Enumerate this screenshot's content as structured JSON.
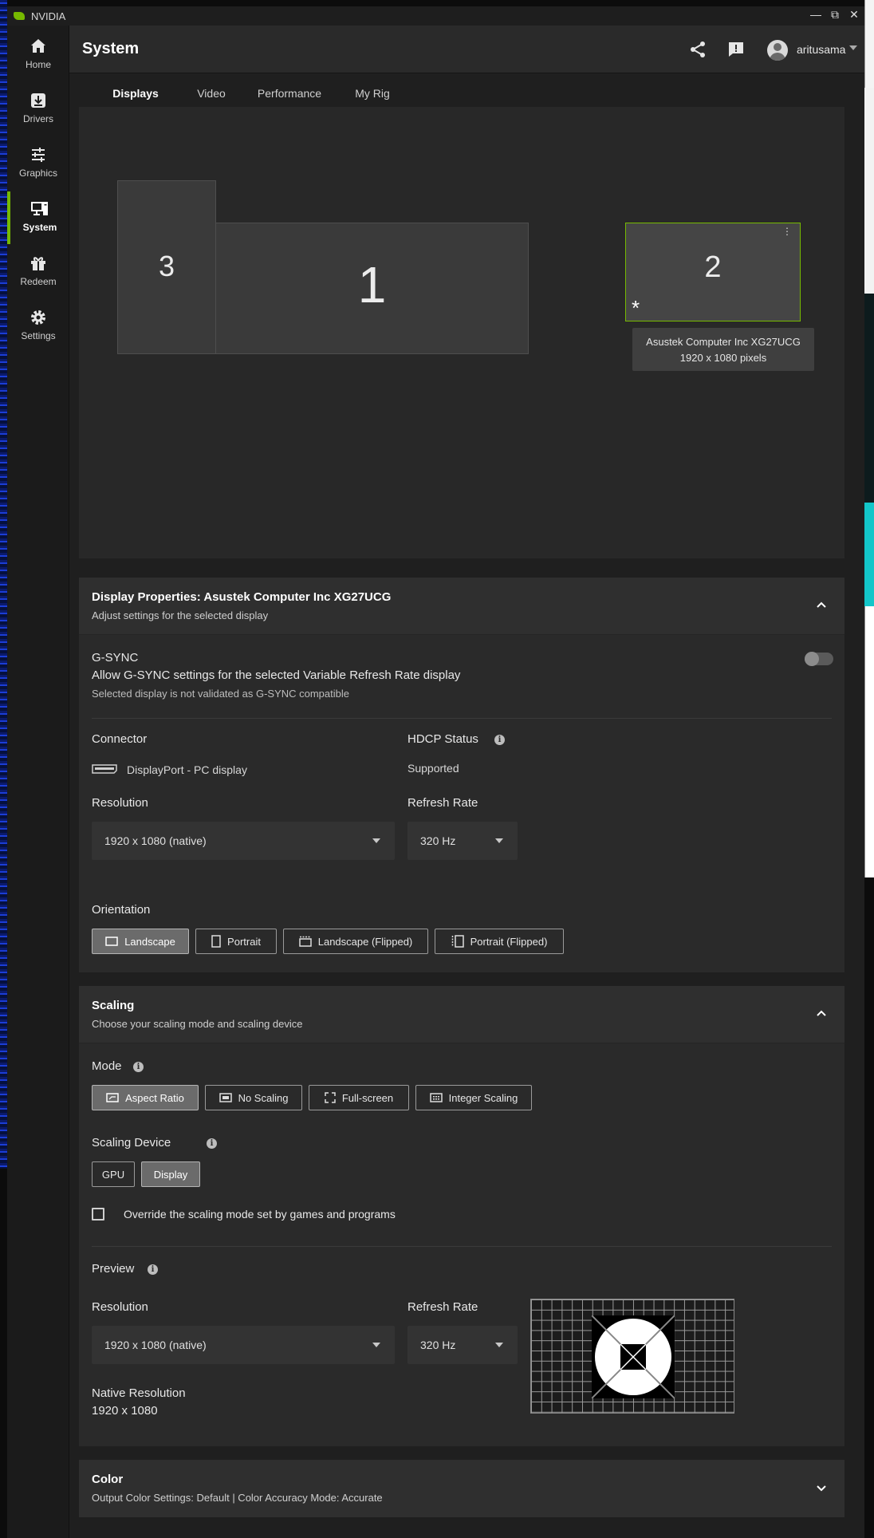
{
  "app": {
    "title": "NVIDIA",
    "brand_color": "#76b900"
  },
  "window_controls": {
    "minimize": "—",
    "restore": "⧉",
    "close": "✕"
  },
  "nav": {
    "items": [
      {
        "label": "Home",
        "icon": "home-icon"
      },
      {
        "label": "Drivers",
        "icon": "download-icon"
      },
      {
        "label": "Graphics",
        "icon": "sliders-icon"
      },
      {
        "label": "System",
        "icon": "system-icon",
        "active": true
      },
      {
        "label": "Redeem",
        "icon": "gift-icon"
      },
      {
        "label": "Settings",
        "icon": "gear-icon"
      }
    ]
  },
  "header": {
    "title": "System",
    "username": "aritusama",
    "icons": [
      "share-icon",
      "feedback-icon",
      "avatar"
    ]
  },
  "tabs": [
    {
      "label": "Displays",
      "active": true
    },
    {
      "label": "Video"
    },
    {
      "label": "Performance"
    },
    {
      "label": "My Rig"
    }
  ],
  "arrangement": {
    "monitors": [
      {
        "number": "3"
      },
      {
        "number": "1"
      },
      {
        "number": "2",
        "selected": true,
        "primary_marker": "*"
      }
    ],
    "tooltip": {
      "name": "Asustek Computer Inc XG27UCG",
      "resolution": "1920 x 1080 pixels"
    }
  },
  "display_properties": {
    "title": "Display Properties: Asustek Computer Inc XG27UCG",
    "subtitle": "Adjust settings for the selected display",
    "gsync": {
      "label": "G-SYNC",
      "description": "Allow G-SYNC settings for the selected Variable Refresh Rate display",
      "note": "Selected display is not validated as G-SYNC compatible",
      "enabled": false
    },
    "connector": {
      "label": "Connector",
      "value": "DisplayPort - PC display"
    },
    "hdcp": {
      "label": "HDCP Status",
      "value": "Supported"
    },
    "resolution": {
      "label": "Resolution",
      "value": "1920 x 1080 (native)"
    },
    "refresh_rate": {
      "label": "Refresh Rate",
      "value": "320 Hz"
    },
    "orientation": {
      "label": "Orientation",
      "options": [
        "Landscape",
        "Portrait",
        "Landscape (Flipped)",
        "Portrait (Flipped)"
      ],
      "selected": "Landscape"
    }
  },
  "scaling": {
    "title": "Scaling",
    "subtitle": "Choose your scaling mode and scaling device",
    "mode": {
      "label": "Mode",
      "options": [
        "Aspect Ratio",
        "No Scaling",
        "Full-screen",
        "Integer Scaling"
      ],
      "selected": "Aspect Ratio"
    },
    "device": {
      "label": "Scaling Device",
      "options": [
        "GPU",
        "Display"
      ],
      "selected": "Display"
    },
    "override": {
      "label": "Override the scaling mode set by games and programs",
      "checked": false
    },
    "preview": {
      "label": "Preview",
      "resolution_label": "Resolution",
      "resolution_value": "1920 x 1080 (native)",
      "refresh_label": "Refresh Rate",
      "refresh_value": "320 Hz",
      "native_label": "Native Resolution",
      "native_value": "1920 x 1080"
    }
  },
  "color": {
    "title": "Color",
    "subtitle": "Output Color Settings: Default | Color Accuracy Mode: Accurate"
  }
}
